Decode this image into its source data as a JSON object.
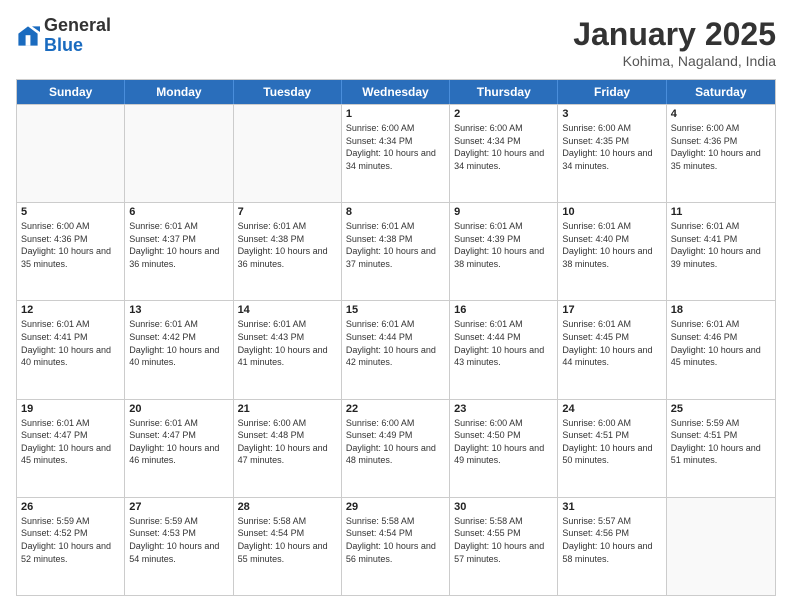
{
  "header": {
    "logo": {
      "general": "General",
      "blue": "Blue"
    },
    "title": "January 2025",
    "subtitle": "Kohima, Nagaland, India"
  },
  "day_headers": [
    "Sunday",
    "Monday",
    "Tuesday",
    "Wednesday",
    "Thursday",
    "Friday",
    "Saturday"
  ],
  "weeks": [
    {
      "days": [
        {
          "num": "",
          "empty": true
        },
        {
          "num": "",
          "empty": true
        },
        {
          "num": "",
          "empty": true
        },
        {
          "num": "1",
          "sunrise": "6:00 AM",
          "sunset": "4:34 PM",
          "daylight": "10 hours and 34 minutes."
        },
        {
          "num": "2",
          "sunrise": "6:00 AM",
          "sunset": "4:34 PM",
          "daylight": "10 hours and 34 minutes."
        },
        {
          "num": "3",
          "sunrise": "6:00 AM",
          "sunset": "4:35 PM",
          "daylight": "10 hours and 34 minutes."
        },
        {
          "num": "4",
          "sunrise": "6:00 AM",
          "sunset": "4:36 PM",
          "daylight": "10 hours and 35 minutes."
        }
      ]
    },
    {
      "days": [
        {
          "num": "5",
          "sunrise": "6:00 AM",
          "sunset": "4:36 PM",
          "daylight": "10 hours and 35 minutes."
        },
        {
          "num": "6",
          "sunrise": "6:01 AM",
          "sunset": "4:37 PM",
          "daylight": "10 hours and 36 minutes."
        },
        {
          "num": "7",
          "sunrise": "6:01 AM",
          "sunset": "4:38 PM",
          "daylight": "10 hours and 36 minutes."
        },
        {
          "num": "8",
          "sunrise": "6:01 AM",
          "sunset": "4:38 PM",
          "daylight": "10 hours and 37 minutes."
        },
        {
          "num": "9",
          "sunrise": "6:01 AM",
          "sunset": "4:39 PM",
          "daylight": "10 hours and 38 minutes."
        },
        {
          "num": "10",
          "sunrise": "6:01 AM",
          "sunset": "4:40 PM",
          "daylight": "10 hours and 38 minutes."
        },
        {
          "num": "11",
          "sunrise": "6:01 AM",
          "sunset": "4:41 PM",
          "daylight": "10 hours and 39 minutes."
        }
      ]
    },
    {
      "days": [
        {
          "num": "12",
          "sunrise": "6:01 AM",
          "sunset": "4:41 PM",
          "daylight": "10 hours and 40 minutes."
        },
        {
          "num": "13",
          "sunrise": "6:01 AM",
          "sunset": "4:42 PM",
          "daylight": "10 hours and 40 minutes."
        },
        {
          "num": "14",
          "sunrise": "6:01 AM",
          "sunset": "4:43 PM",
          "daylight": "10 hours and 41 minutes."
        },
        {
          "num": "15",
          "sunrise": "6:01 AM",
          "sunset": "4:44 PM",
          "daylight": "10 hours and 42 minutes."
        },
        {
          "num": "16",
          "sunrise": "6:01 AM",
          "sunset": "4:44 PM",
          "daylight": "10 hours and 43 minutes."
        },
        {
          "num": "17",
          "sunrise": "6:01 AM",
          "sunset": "4:45 PM",
          "daylight": "10 hours and 44 minutes."
        },
        {
          "num": "18",
          "sunrise": "6:01 AM",
          "sunset": "4:46 PM",
          "daylight": "10 hours and 45 minutes."
        }
      ]
    },
    {
      "days": [
        {
          "num": "19",
          "sunrise": "6:01 AM",
          "sunset": "4:47 PM",
          "daylight": "10 hours and 45 minutes."
        },
        {
          "num": "20",
          "sunrise": "6:01 AM",
          "sunset": "4:47 PM",
          "daylight": "10 hours and 46 minutes."
        },
        {
          "num": "21",
          "sunrise": "6:00 AM",
          "sunset": "4:48 PM",
          "daylight": "10 hours and 47 minutes."
        },
        {
          "num": "22",
          "sunrise": "6:00 AM",
          "sunset": "4:49 PM",
          "daylight": "10 hours and 48 minutes."
        },
        {
          "num": "23",
          "sunrise": "6:00 AM",
          "sunset": "4:50 PM",
          "daylight": "10 hours and 49 minutes."
        },
        {
          "num": "24",
          "sunrise": "6:00 AM",
          "sunset": "4:51 PM",
          "daylight": "10 hours and 50 minutes."
        },
        {
          "num": "25",
          "sunrise": "5:59 AM",
          "sunset": "4:51 PM",
          "daylight": "10 hours and 51 minutes."
        }
      ]
    },
    {
      "days": [
        {
          "num": "26",
          "sunrise": "5:59 AM",
          "sunset": "4:52 PM",
          "daylight": "10 hours and 52 minutes."
        },
        {
          "num": "27",
          "sunrise": "5:59 AM",
          "sunset": "4:53 PM",
          "daylight": "10 hours and 54 minutes."
        },
        {
          "num": "28",
          "sunrise": "5:58 AM",
          "sunset": "4:54 PM",
          "daylight": "10 hours and 55 minutes."
        },
        {
          "num": "29",
          "sunrise": "5:58 AM",
          "sunset": "4:54 PM",
          "daylight": "10 hours and 56 minutes."
        },
        {
          "num": "30",
          "sunrise": "5:58 AM",
          "sunset": "4:55 PM",
          "daylight": "10 hours and 57 minutes."
        },
        {
          "num": "31",
          "sunrise": "5:57 AM",
          "sunset": "4:56 PM",
          "daylight": "10 hours and 58 minutes."
        },
        {
          "num": "",
          "empty": true
        }
      ]
    }
  ]
}
